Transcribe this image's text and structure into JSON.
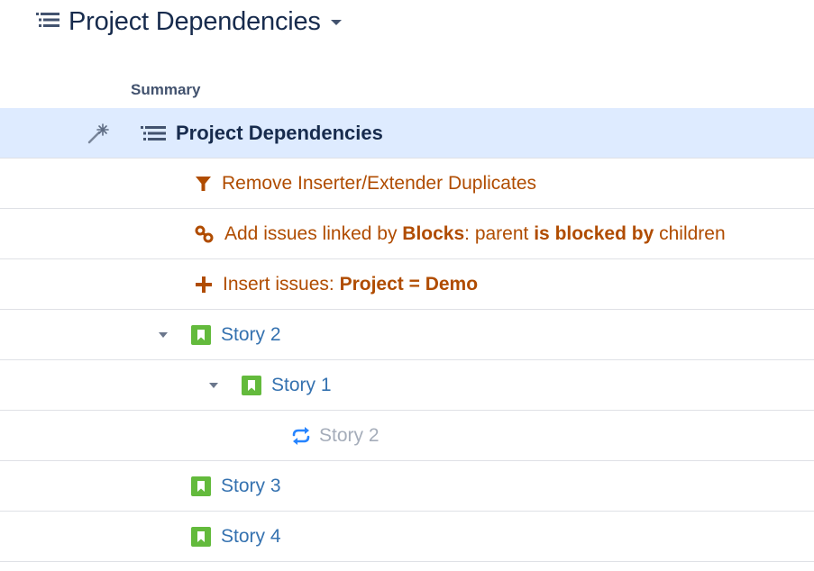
{
  "title": {
    "text": "Project Dependencies",
    "icon": "structure-icon",
    "menu_icon": "caret-down-icon"
  },
  "column_header": "Summary",
  "rows": [
    {
      "kind": "root",
      "label": "Project Dependencies",
      "icon": "structure-icon",
      "marker_icon": "magic-wand-icon"
    },
    {
      "kind": "generator",
      "icon": "filter-icon",
      "parts": [
        "Remove Inserter/Extender Duplicates"
      ]
    },
    {
      "kind": "generator",
      "icon": "link-icon",
      "parts": [
        "Add issues linked by ",
        "Blocks",
        ": parent ",
        "is blocked by",
        " children"
      ]
    },
    {
      "kind": "generator",
      "icon": "plus-icon",
      "parts": [
        "Insert issues: ",
        "Project = Demo"
      ]
    },
    {
      "kind": "issue",
      "label": "Story 2",
      "icon": "story-icon",
      "expanded": true
    },
    {
      "kind": "issue",
      "label": "Story 1",
      "icon": "story-icon",
      "expanded": true
    },
    {
      "kind": "duplicate",
      "label": "Story 2",
      "icon": "recurring-icon"
    },
    {
      "kind": "issue",
      "label": "Story 3",
      "icon": "story-icon"
    },
    {
      "kind": "issue",
      "label": "Story 4",
      "icon": "story-icon"
    }
  ],
  "colors": {
    "generator": "#b04c00",
    "issue_link": "#3572b0",
    "story_icon": "#63ba3c",
    "recurring_icon": "#2684ff",
    "selected_row": "#deebff"
  }
}
